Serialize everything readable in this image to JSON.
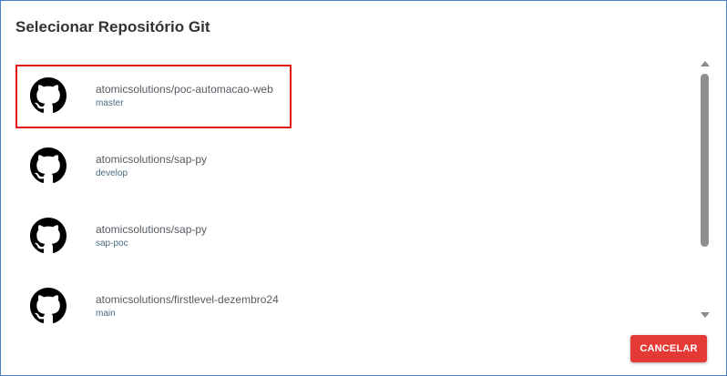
{
  "dialog": {
    "title": "Selecionar Repositório Git",
    "cancel_label": "CANCELAR",
    "accent_color": "#e53935",
    "selection_color": "#e01212"
  },
  "repos": [
    {
      "name": "atomicsolutions/poc-automacao-web",
      "branch": "master",
      "icon": "github-icon",
      "selected": true
    },
    {
      "name": "atomicsolutions/sap-py",
      "branch": "develop",
      "icon": "github-icon",
      "selected": false
    },
    {
      "name": "atomicsolutions/sap-py",
      "branch": "sap-poc",
      "icon": "github-icon",
      "selected": false
    },
    {
      "name": "atomicsolutions/firstlevel-dezembro24",
      "branch": "main",
      "icon": "github-icon",
      "selected": false
    }
  ]
}
